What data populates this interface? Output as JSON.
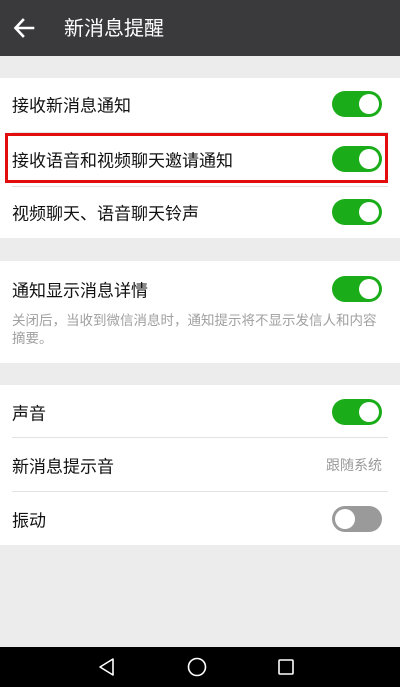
{
  "header": {
    "title": "新消息提醒",
    "back_icon": "arrow-left-icon"
  },
  "section1": {
    "items": [
      {
        "label": "接收新消息通知",
        "enabled": true
      },
      {
        "label": "接收语音和视频聊天邀请通知",
        "enabled": true
      },
      {
        "label": "视频聊天、语音聊天铃声",
        "enabled": true
      }
    ]
  },
  "section2": {
    "label": "通知显示消息详情",
    "enabled": true,
    "description": "关闭后，当收到微信消息时，通知提示将不显示发信人和内容摘要。"
  },
  "section3": {
    "sound": {
      "label": "声音",
      "enabled": true
    },
    "ringtone": {
      "label": "新消息提示音",
      "value": "跟随系统"
    },
    "vibrate": {
      "label": "振动",
      "enabled": false
    }
  },
  "colors": {
    "toggle_on": "#1aad19",
    "toggle_off": "#9a9a9a",
    "highlight": "#e20e0e",
    "topbar": "#3a3a3d"
  },
  "navbar": {
    "icons": [
      "back-triangle-icon",
      "home-circle-icon",
      "recents-square-icon"
    ]
  }
}
